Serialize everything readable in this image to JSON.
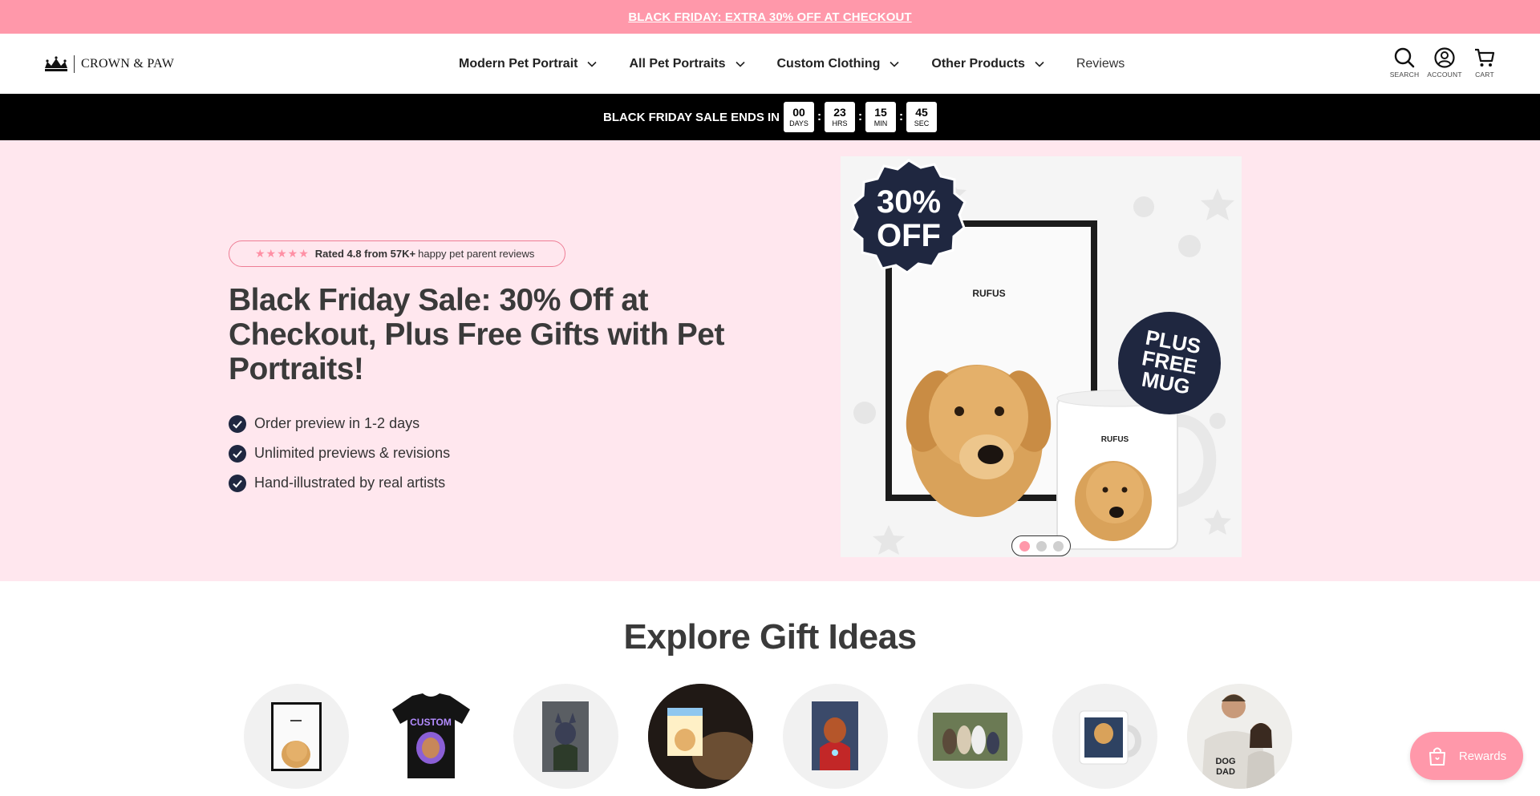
{
  "announcement": {
    "text": "BLACK FRIDAY: EXTRA 30% OFF AT CHECKOUT"
  },
  "header": {
    "logo_text": "CROWN & PAW",
    "nav": [
      {
        "label": "Modern Pet Portrait",
        "has_dropdown": true
      },
      {
        "label": "All Pet Portraits",
        "has_dropdown": true
      },
      {
        "label": "Custom Clothing",
        "has_dropdown": true
      },
      {
        "label": "Other Products",
        "has_dropdown": true
      },
      {
        "label": "Reviews",
        "has_dropdown": false
      }
    ],
    "icons": [
      {
        "icon": "search-icon",
        "label": "SEARCH"
      },
      {
        "icon": "account-icon",
        "label": "ACCOUNT"
      },
      {
        "icon": "cart-icon",
        "label": "CART"
      }
    ]
  },
  "countdown": {
    "label": "BLACK FRIDAY SALE ENDS IN",
    "units": [
      {
        "value": "00",
        "unit": "DAYS"
      },
      {
        "value": "23",
        "unit": "HRS"
      },
      {
        "value": "15",
        "unit": "MIN"
      },
      {
        "value": "45",
        "unit": "SEC"
      }
    ]
  },
  "hero": {
    "rating": {
      "stars": 5,
      "bold": "Rated 4.8 from 57K+",
      "rest": "happy pet parent reviews"
    },
    "title": "Black Friday Sale: 30% Off at Checkout, Plus Free Gifts with Pet Portraits!",
    "benefits": [
      "Order preview in 1-2 days",
      "Unlimited previews & revisions",
      "Hand-illustrated by real artists"
    ],
    "image": {
      "badge_top_line1": "30%",
      "badge_top_line2": "OFF",
      "frame_name": "RUFUS",
      "mug_name": "RUFUS",
      "badge_bottom_line1": "PLUS",
      "badge_bottom_line2": "FREE",
      "badge_bottom_line3": "MUG"
    },
    "carousel": {
      "count": 3,
      "active": 0
    }
  },
  "explore": {
    "title": "Explore Gift Ideas",
    "items": [
      {
        "name": "framed-portrait",
        "icon": "framed-dog-portrait-icon"
      },
      {
        "name": "custom-tshirt",
        "icon": "custom-tshirt-icon",
        "text": "CUSTOM"
      },
      {
        "name": "canvas-portrait",
        "icon": "canvas-portrait-icon"
      },
      {
        "name": "night-light",
        "icon": "night-light-portrait-icon"
      },
      {
        "name": "superhero-canvas",
        "icon": "superhero-canvas-icon"
      },
      {
        "name": "family-portrait",
        "icon": "family-portrait-icon"
      },
      {
        "name": "mug",
        "icon": "mug-icon"
      },
      {
        "name": "dog-dad-apparel",
        "icon": "apparel-models-icon",
        "text_line1": "DOG",
        "text_line2": "DAD"
      }
    ]
  },
  "rewards": {
    "label": "Rewards",
    "icon": "gift-bag-icon"
  },
  "colors": {
    "accent_pink": "#ff98aa",
    "hero_bg": "#ffe7ee",
    "navy": "#1f2740"
  }
}
